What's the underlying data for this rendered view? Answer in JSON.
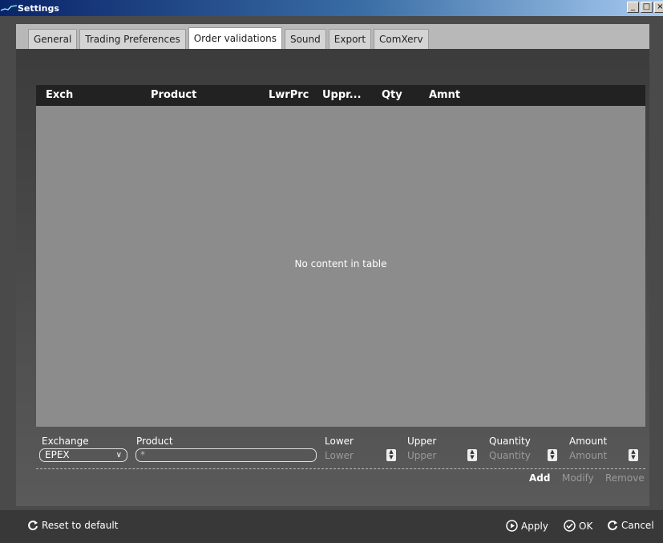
{
  "window": {
    "title": "Settings"
  },
  "tabs": [
    {
      "label": "General"
    },
    {
      "label": "Trading Preferences"
    },
    {
      "label": "Order validations",
      "active": true
    },
    {
      "label": "Sound"
    },
    {
      "label": "Export"
    },
    {
      "label": "ComXerv"
    }
  ],
  "table": {
    "columns": [
      "Exch",
      "Product",
      "LwrPrc",
      "Uppr...",
      "Qty",
      "Amnt"
    ],
    "rows": [],
    "empty_message": "No content in table"
  },
  "form": {
    "exchange": {
      "label": "Exchange",
      "value": "EPEX"
    },
    "product": {
      "label": "Product",
      "value": "*"
    },
    "lower": {
      "label": "Lower",
      "placeholder": "Lower"
    },
    "upper": {
      "label": "Upper",
      "placeholder": "Upper"
    },
    "quantity": {
      "label": "Quantity",
      "placeholder": "Quantity"
    },
    "amount": {
      "label": "Amount",
      "placeholder": "Amount"
    }
  },
  "actions": {
    "add": "Add",
    "modify": "Modify",
    "remove": "Remove"
  },
  "footer": {
    "reset": "Reset to default",
    "apply": "Apply",
    "ok": "OK",
    "cancel": "Cancel"
  },
  "colors": {
    "title_bar": "#0a246a",
    "header_bg": "#222222",
    "table_bg": "#8c8c8c"
  }
}
